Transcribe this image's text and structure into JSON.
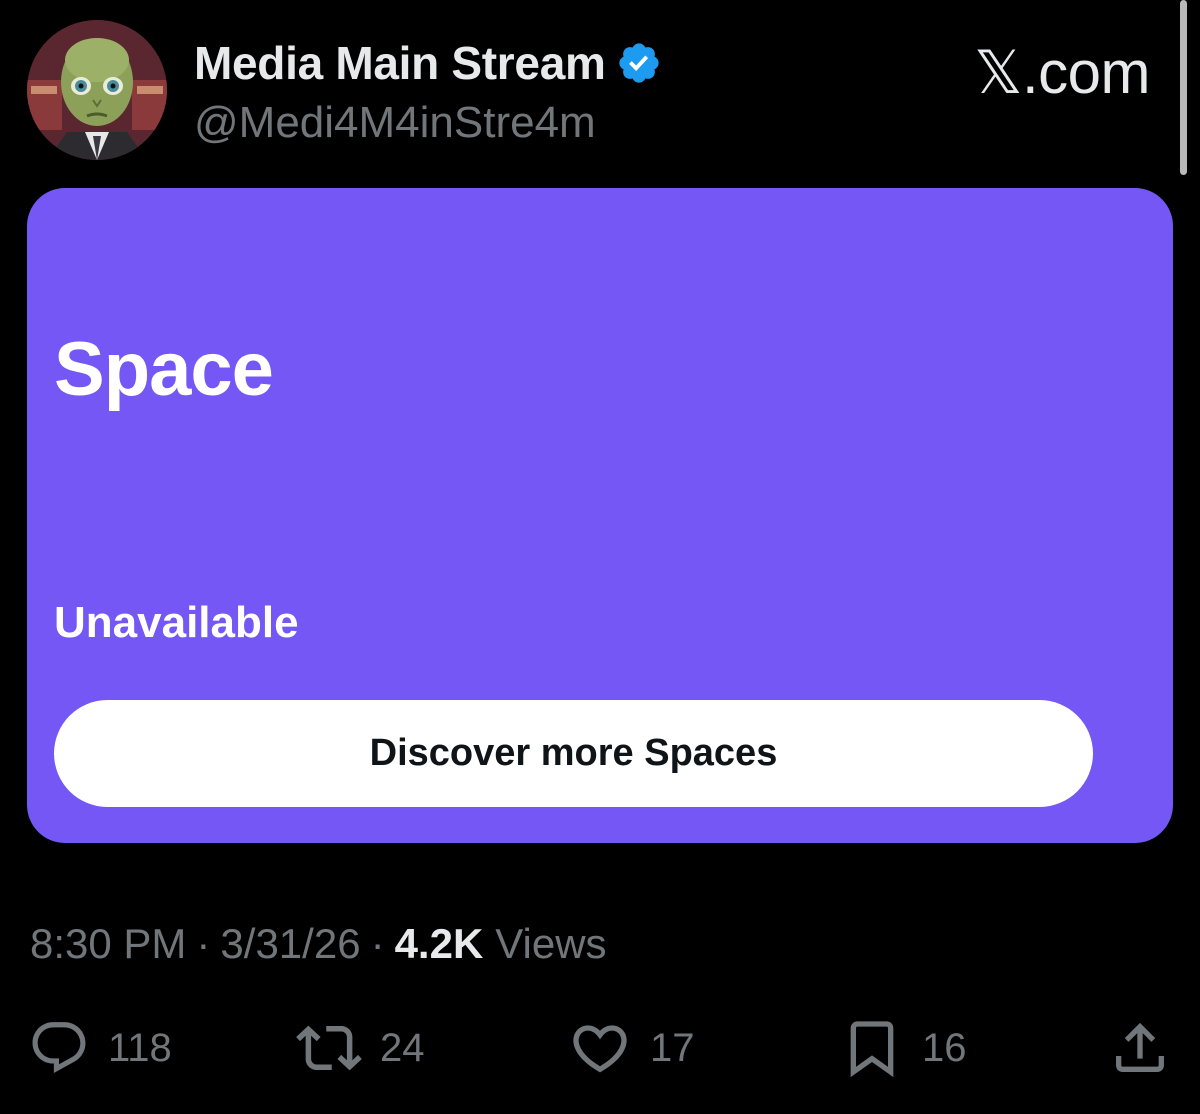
{
  "tweet": {
    "author": {
      "display_name": "Media Main Stream",
      "handle": "@Medi4M4inStre4m",
      "verified": true
    },
    "watermark": "𝕏.com",
    "space": {
      "title": "Space",
      "status": "Unavailable",
      "button_label": "Discover more Spaces",
      "background_color": "#7457f4"
    },
    "meta": {
      "time": "8:30 PM",
      "date": "3/31/26",
      "views_count": "4.2K",
      "views_label": "Views",
      "separator": "·"
    },
    "actions": [
      {
        "icon": "reply-icon",
        "count": "118"
      },
      {
        "icon": "retweet-icon",
        "count": "24"
      },
      {
        "icon": "like-icon",
        "count": "17"
      },
      {
        "icon": "bookmark-icon",
        "count": "16"
      },
      {
        "icon": "share-icon",
        "count": ""
      }
    ],
    "colors": {
      "background": "#000000",
      "primary_text": "#e7e9ea",
      "secondary_text": "#71767b",
      "verified_badge": "#1d9bf0"
    }
  }
}
